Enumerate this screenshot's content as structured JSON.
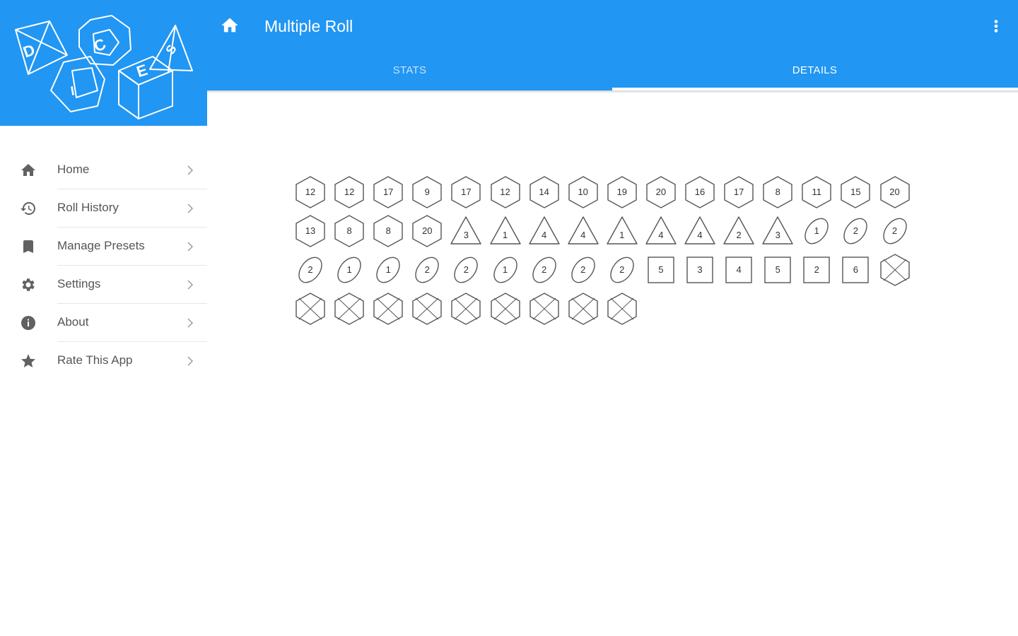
{
  "app": {
    "title": "Multiple Roll"
  },
  "tabs": [
    {
      "label": "STATS",
      "active": false
    },
    {
      "label": "DETAILS",
      "active": true
    }
  ],
  "logo": {
    "letters": [
      "D",
      "C",
      "E",
      "S",
      "I"
    ]
  },
  "drawer": {
    "items": [
      {
        "label": "Home",
        "icon": "home-icon"
      },
      {
        "label": "Roll History",
        "icon": "history-icon"
      },
      {
        "label": "Manage Presets",
        "icon": "bookmark-icon"
      },
      {
        "label": "Settings",
        "icon": "gear-icon"
      },
      {
        "label": "About",
        "icon": "info-icon"
      },
      {
        "label": "Rate This App",
        "icon": "star-icon"
      }
    ]
  },
  "colors": {
    "primary": "#2196F3",
    "icon_gray": "#616161",
    "die_stroke": "#555555"
  },
  "dice": [
    {
      "type": "d20",
      "value": "12"
    },
    {
      "type": "d20",
      "value": "12"
    },
    {
      "type": "d20",
      "value": "17"
    },
    {
      "type": "d20",
      "value": "9"
    },
    {
      "type": "d20",
      "value": "17"
    },
    {
      "type": "d20",
      "value": "12"
    },
    {
      "type": "d20",
      "value": "14"
    },
    {
      "type": "d20",
      "value": "10"
    },
    {
      "type": "d20",
      "value": "19"
    },
    {
      "type": "d20",
      "value": "20"
    },
    {
      "type": "d20",
      "value": "16"
    },
    {
      "type": "d20",
      "value": "17"
    },
    {
      "type": "d20",
      "value": "8"
    },
    {
      "type": "d20",
      "value": "11"
    },
    {
      "type": "d20",
      "value": "15"
    },
    {
      "type": "d20",
      "value": "20"
    },
    {
      "type": "d20",
      "value": "13"
    },
    {
      "type": "d20",
      "value": "8"
    },
    {
      "type": "d20",
      "value": "8"
    },
    {
      "type": "d20",
      "value": "20"
    },
    {
      "type": "d4",
      "value": "3"
    },
    {
      "type": "d4",
      "value": "1"
    },
    {
      "type": "d4",
      "value": "4"
    },
    {
      "type": "d4",
      "value": "4"
    },
    {
      "type": "d4",
      "value": "1"
    },
    {
      "type": "d4",
      "value": "4"
    },
    {
      "type": "d4",
      "value": "4"
    },
    {
      "type": "d4",
      "value": "2"
    },
    {
      "type": "d4",
      "value": "3"
    },
    {
      "type": "coin",
      "value": "1"
    },
    {
      "type": "coin",
      "value": "2"
    },
    {
      "type": "coin",
      "value": "2"
    },
    {
      "type": "coin",
      "value": "2"
    },
    {
      "type": "coin",
      "value": "1"
    },
    {
      "type": "coin",
      "value": "1"
    },
    {
      "type": "coin",
      "value": "2"
    },
    {
      "type": "coin",
      "value": "2"
    },
    {
      "type": "coin",
      "value": "1"
    },
    {
      "type": "coin",
      "value": "2"
    },
    {
      "type": "coin",
      "value": "2"
    },
    {
      "type": "coin",
      "value": "2"
    },
    {
      "type": "d6",
      "value": "5"
    },
    {
      "type": "d6",
      "value": "3"
    },
    {
      "type": "d6",
      "value": "4"
    },
    {
      "type": "d6",
      "value": "5"
    },
    {
      "type": "d6",
      "value": "2"
    },
    {
      "type": "d6",
      "value": "6"
    },
    {
      "type": "blank",
      "value": ""
    },
    {
      "type": "blank",
      "value": ""
    },
    {
      "type": "blank",
      "value": ""
    },
    {
      "type": "blank",
      "value": ""
    },
    {
      "type": "blank",
      "value": ""
    },
    {
      "type": "blank",
      "value": ""
    },
    {
      "type": "blank",
      "value": ""
    },
    {
      "type": "blank",
      "value": ""
    },
    {
      "type": "blank",
      "value": ""
    },
    {
      "type": "blank",
      "value": ""
    }
  ]
}
